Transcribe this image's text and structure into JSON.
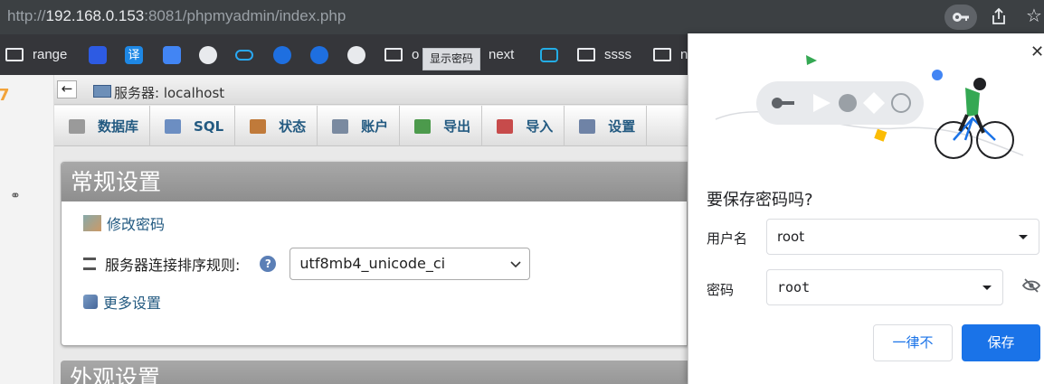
{
  "browser": {
    "url_prefix": "http://",
    "url_host": "192.168.0.153",
    "url_rest": ":8081/phpmyadmin/index.php",
    "icons": [
      "key-icon",
      "share-icon",
      "star-icon"
    ]
  },
  "bookmarks": {
    "items": [
      {
        "label": "range",
        "icon": "folder-icon"
      },
      {
        "label": "",
        "icon": "baidu-icon"
      },
      {
        "label": "",
        "icon": "translate-icon"
      },
      {
        "label": "",
        "icon": "google-translate-icon"
      },
      {
        "label": "",
        "icon": "github-icon"
      },
      {
        "label": "",
        "icon": "cloud-icon"
      },
      {
        "label": "",
        "icon": "app-icon"
      },
      {
        "label": "",
        "icon": "app-icon"
      },
      {
        "label": "",
        "icon": "globe-icon"
      },
      {
        "label": "o",
        "icon": "folder-icon"
      },
      {
        "label": "next",
        "icon": "folder-icon"
      },
      {
        "label": "",
        "icon": "bilibili-icon"
      },
      {
        "label": "ssss",
        "icon": "folder-icon"
      },
      {
        "label": "n",
        "icon": "folder-icon"
      }
    ],
    "tooltip": "显示密码"
  },
  "pma": {
    "server_label": "服务器: localhost",
    "tabs": [
      {
        "label": "数据库",
        "icon": "database-icon",
        "color": "#9a9a9a"
      },
      {
        "label": "SQL",
        "icon": "sql-icon",
        "color": "#6c8ec2"
      },
      {
        "label": "状态",
        "icon": "status-icon",
        "color": "#c07a3a"
      },
      {
        "label": "账户",
        "icon": "accounts-icon",
        "color": "#7a8aa0"
      },
      {
        "label": "导出",
        "icon": "export-icon",
        "color": "#4c9a4c"
      },
      {
        "label": "导入",
        "icon": "import-icon",
        "color": "#c74b4b"
      },
      {
        "label": "设置",
        "icon": "settings-icon",
        "color": "#6f83a6"
      }
    ],
    "general_title": "常规设置",
    "change_password": "修改密码",
    "collation_label": "服务器连接排序规则:",
    "collation_value": "utf8mb4_unicode_ci",
    "more_settings": "更多设置",
    "appearance_title": "外观设置"
  },
  "popup": {
    "title": "要保存密码吗?",
    "username_label": "用户名",
    "username_value": "root",
    "password_label": "密码",
    "password_value": "root",
    "never_button": "一律不",
    "save_button": "保存",
    "accent": "#1a73e8"
  }
}
